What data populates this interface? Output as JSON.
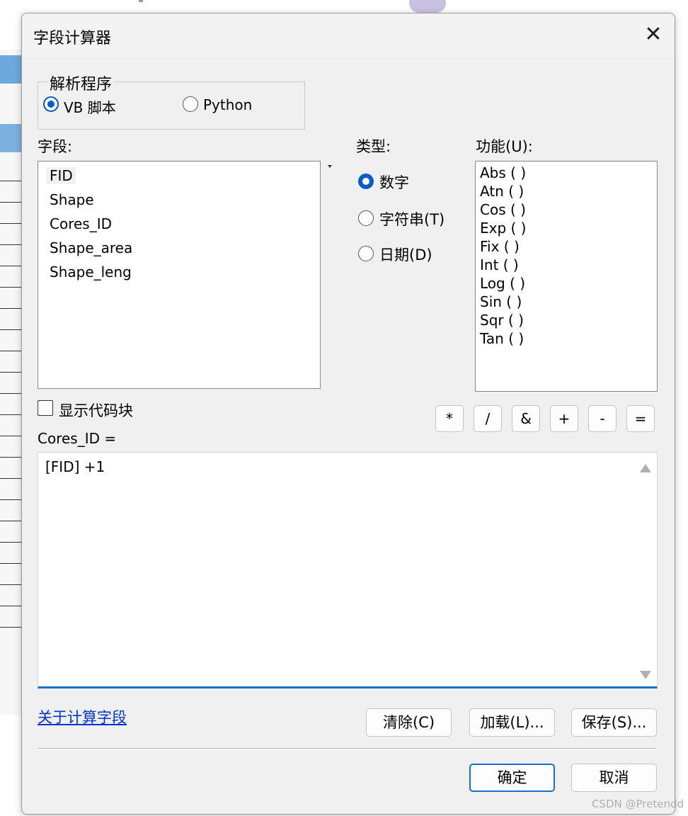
{
  "dialog": {
    "title": "字段计算器"
  },
  "parser": {
    "legend": "解析程序",
    "options": [
      "VB 脚本",
      "Python"
    ],
    "selected": "VB 脚本"
  },
  "fields": {
    "label": "字段:",
    "items": [
      "FID",
      "Shape",
      "Cores_ID",
      "Shape_area",
      "Shape_leng"
    ],
    "selected": "FID"
  },
  "type": {
    "label": "类型:",
    "options": [
      "数字",
      "字符串(T)",
      "日期(D)"
    ],
    "selected": "数字"
  },
  "functions": {
    "label": "功能(U):",
    "items": [
      "Abs ( )",
      "Atn ( )",
      "Cos ( )",
      "Exp ( )",
      "Fix ( )",
      "Int ( )",
      "Log ( )",
      "Sin ( )",
      "Sqr ( )",
      "Tan ( )"
    ]
  },
  "show_codeblock": {
    "label": "显示代码块",
    "checked": false
  },
  "operators": [
    "*",
    "/",
    "&",
    "+",
    "-",
    "="
  ],
  "expression": {
    "label": "Cores_ID =",
    "value": "[FID] +1"
  },
  "help_link": "关于计算字段",
  "buttons": {
    "clear": "清除(C)",
    "load": "加载(L)...",
    "save": "保存(S)...",
    "ok": "确定",
    "cancel": "取消"
  },
  "watermark": "CSDN @Pretendd"
}
